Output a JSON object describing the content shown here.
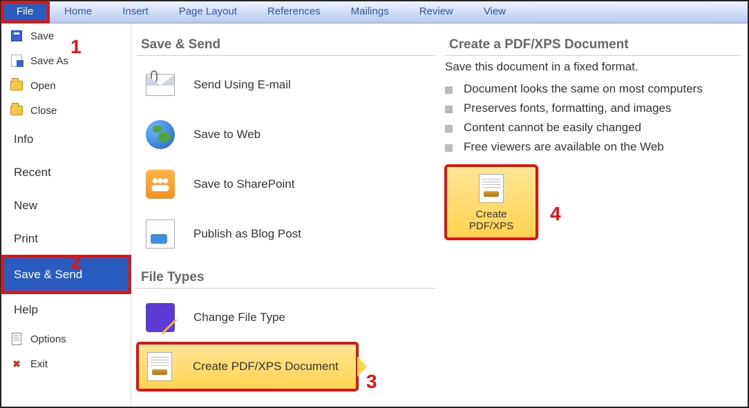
{
  "ribbon": {
    "tabs": [
      "File",
      "Home",
      "Insert",
      "Page Layout",
      "References",
      "Mailings",
      "Review",
      "View"
    ]
  },
  "sidebar": {
    "items": [
      {
        "label": "Save"
      },
      {
        "label": "Save As"
      },
      {
        "label": "Open"
      },
      {
        "label": "Close"
      },
      {
        "label": "Info"
      },
      {
        "label": "Recent"
      },
      {
        "label": "New"
      },
      {
        "label": "Print"
      },
      {
        "label": "Save & Send"
      },
      {
        "label": "Help"
      },
      {
        "label": "Options"
      },
      {
        "label": "Exit"
      }
    ]
  },
  "mid": {
    "section1": "Save & Send",
    "section2": "File Types",
    "items": [
      {
        "label": "Send Using E-mail"
      },
      {
        "label": "Save to Web"
      },
      {
        "label": "Save to SharePoint"
      },
      {
        "label": "Publish as Blog Post"
      },
      {
        "label": "Change File Type"
      },
      {
        "label": "Create PDF/XPS Document"
      }
    ]
  },
  "right": {
    "title": "Create a PDF/XPS Document",
    "lead": "Save this document in a fixed format.",
    "bullets": [
      "Document looks the same on most computers",
      "Preserves fonts, formatting, and images",
      "Content cannot be easily changed",
      "Free viewers are available on the Web"
    ],
    "button_line1": "Create",
    "button_line2": "PDF/XPS"
  },
  "annotations": {
    "n1": "1",
    "n2": "2",
    "n3": "3",
    "n4": "4"
  }
}
